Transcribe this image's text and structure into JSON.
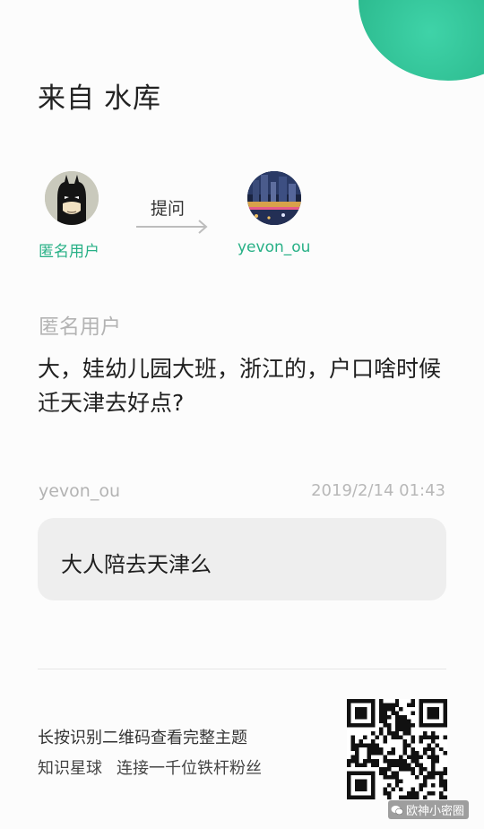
{
  "header": {
    "prefix": "来自",
    "source_name": "水库"
  },
  "flow": {
    "asker_name": "匿名用户",
    "verb": "提问",
    "answerer_name": "yevon_ou",
    "asker_avatar_icon": "batman-mask-icon",
    "answerer_avatar_icon": "city-night-photo-icon"
  },
  "question": {
    "author": "匿名用户",
    "text": "大，娃幼儿园大班，浙江的，户口啥时候迁天津去好点?"
  },
  "answer": {
    "author": "yevon_ou",
    "timestamp": "2019/2/14 01:43",
    "text": "大人陪去天津么"
  },
  "footer": {
    "prompt": "长按识别二维码查看完整主题",
    "brand": "知识星球",
    "slogan": "连接一千位铁杆粉丝",
    "qr_icon": "qr-code-icon"
  },
  "watermark": {
    "text": "欧神小密圈",
    "icon": "wechat-icon"
  },
  "colors": {
    "accent": "#27b086",
    "corner_gradient": "#2bb98d",
    "muted_text": "#b3b3b3",
    "bubble": "#eeeeee"
  }
}
